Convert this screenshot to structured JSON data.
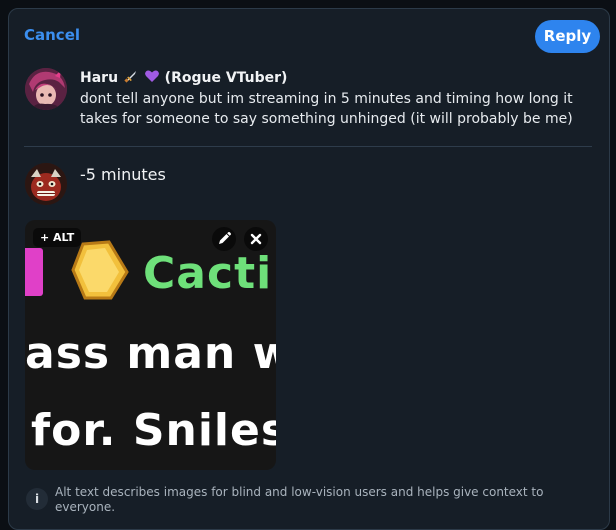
{
  "header": {
    "cancel_label": "Cancel",
    "reply_label": "Reply"
  },
  "parent_post": {
    "author_name": "Haru",
    "author_suffix": "(Rogue VTuber)",
    "author_emojis": [
      "dagger-icon",
      "purple-heart-icon"
    ],
    "text": "dont tell anyone but im streaming in 5 minutes and timing how long it takes for someone to say something unhinged (it will probably be me)"
  },
  "composer": {
    "text": "-5 minutes",
    "attached_image": {
      "visible_text_lines": [
        "Cacti",
        "ass man wh",
        "for. Sniles s"
      ],
      "alt_label": "+ ALT",
      "edit_icon": "pencil-icon",
      "remove_icon": "close-icon"
    }
  },
  "alt_info": {
    "icon": "info-icon",
    "text": "Alt text describes images for blind and low-vision users and helps give context to everyone."
  },
  "colors": {
    "accent": "#2e84ee",
    "background": "#161e27",
    "image_green": "#6ee07a"
  }
}
